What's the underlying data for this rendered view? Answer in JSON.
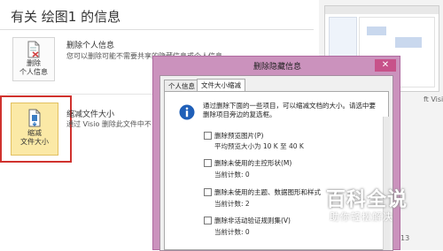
{
  "info": {
    "title": "有关 绘图1 的信息"
  },
  "sections": {
    "personal": {
      "button_label_1": "删除",
      "button_label_2": "个人信息",
      "heading": "删除个人信息",
      "description": "您可以删除可能不需要共享的隐藏信息或个人信息"
    },
    "compress": {
      "button_label_1": "缩减",
      "button_label_2": "文件大小",
      "heading": "缩减文件大小",
      "description": "通过 Visio 删除此文件中不"
    }
  },
  "side": {
    "text": "ft Visio 绘图",
    "number": "13"
  },
  "dialog": {
    "title": "删除隐藏信息",
    "close_glyph": "✕",
    "tabs": [
      {
        "label": "个人信息"
      },
      {
        "label": "文件大小缩减"
      }
    ],
    "intro": "通过删除下面的一些项目，可以缩减文档的大小。请选中要删除项目旁边的复选框。",
    "options": [
      {
        "label": "删除预览图片(P)",
        "detail": "平均预览大小为 10 K 至 40 K"
      },
      {
        "label": "删除未使用的主控形状(M)",
        "detail": "当前计数: 0"
      },
      {
        "label": "删除未使用的主题、数据图形和样式",
        "detail": "当前计数: 2"
      },
      {
        "label": "删除非活动验证规则集(V)",
        "detail": "当前计数: 0"
      }
    ]
  },
  "watermark": {
    "main": "百科全说",
    "sub": "助你轻松解决"
  },
  "colors": {
    "dialog_frame": "#cb92bd",
    "close_button": "#c7528a",
    "highlight_border": "#d0322e",
    "selected_tile": "#fbe9a6"
  }
}
